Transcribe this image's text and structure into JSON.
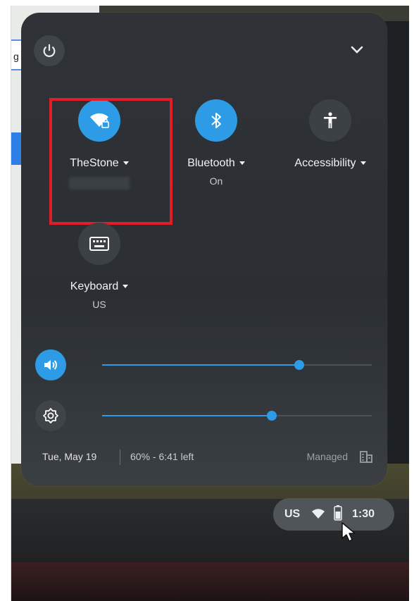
{
  "background": {
    "input_fragment": "g"
  },
  "panel": {
    "tiles": {
      "network": {
        "label": "TheStone",
        "icon": "wifi-lock-icon",
        "active": true
      },
      "bluetooth": {
        "label": "Bluetooth",
        "sub": "On",
        "icon": "bluetooth-icon",
        "active": true
      },
      "accessibility": {
        "label": "Accessibility",
        "icon": "accessibility-icon",
        "active": false
      },
      "keyboard": {
        "label": "Keyboard",
        "sub": "US",
        "icon": "keyboard-icon",
        "active": false
      }
    },
    "sliders": {
      "volume": {
        "icon": "volume-icon",
        "level": 0.73
      },
      "brightness": {
        "icon": "brightness-icon",
        "level": 0.63
      }
    },
    "footer": {
      "date": "Tue, May 19",
      "battery": "60% - 6:41 left",
      "managed": "Managed"
    }
  },
  "shelf": {
    "ime": "US",
    "time": "1:30"
  },
  "colors": {
    "accent": "#2e9be6",
    "panel_bg": "#2f3337",
    "highlight": "#e11d26"
  }
}
